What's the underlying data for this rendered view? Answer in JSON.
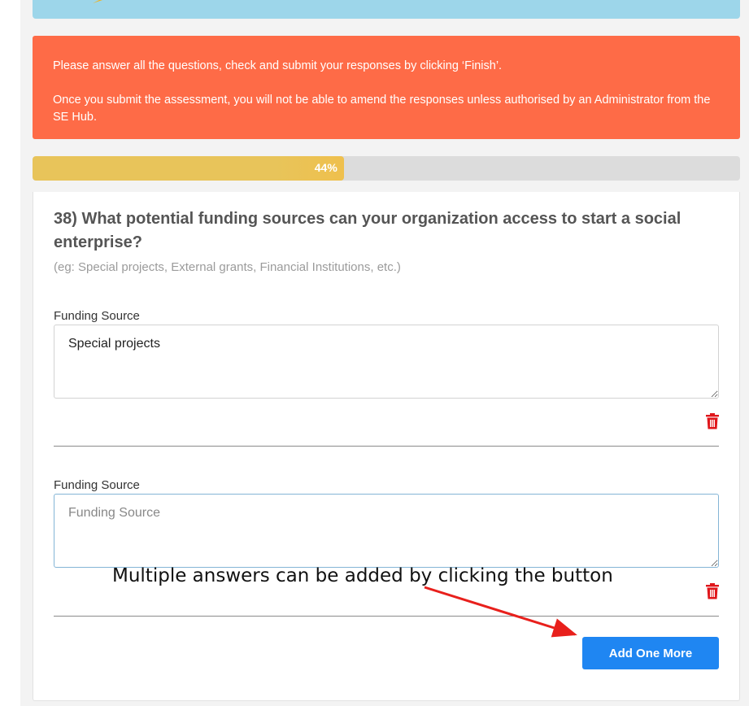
{
  "alert": {
    "line1": "Please answer all the questions, check and submit your responses by clicking ‘Finish’.",
    "line2": "Once you submit the assessment, you will not be able to amend the responses unless authorised by an Administrator from the SE Hub."
  },
  "progress": {
    "percent": 44,
    "label": "44%"
  },
  "question": {
    "text": "38) What potential funding sources can your organization access to start a social enterprise?",
    "hint": "(eg: Special projects, External grants, Financial Institutions, etc.)"
  },
  "answers": [
    {
      "label": "Funding Source",
      "value": "Special projects",
      "placeholder": "Funding Source"
    },
    {
      "label": "Funding Source",
      "value": "",
      "placeholder": "Funding Source"
    }
  ],
  "add_button": {
    "label": "Add One More"
  },
  "annotation": {
    "text": "Multiple answers can be added by clicking the button",
    "color": "#e8201c"
  },
  "colors": {
    "alert": "#fe6b47",
    "progress": "#e8c45a",
    "button": "#1f86f2",
    "trash": "#e0161b",
    "banner": "#9dd6ea"
  },
  "icons": {
    "trash": "trash-icon",
    "banner": "speech-bubble-icon"
  }
}
